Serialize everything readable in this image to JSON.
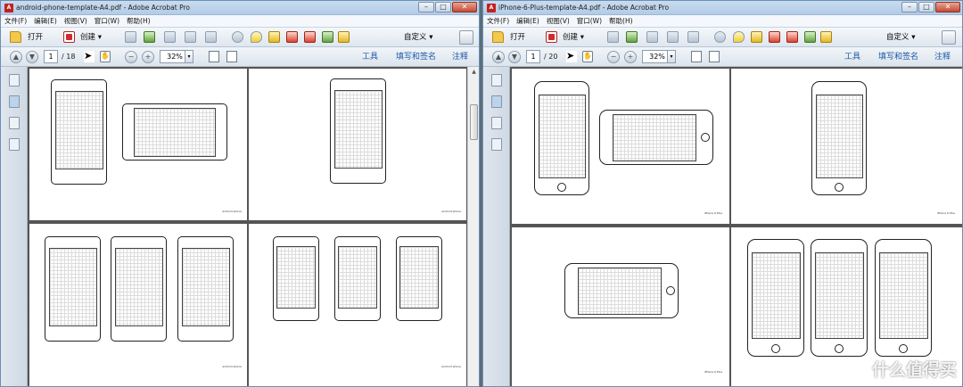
{
  "windows": [
    {
      "title": "android-phone-template-A4.pdf - Adobe Acrobat Pro",
      "menu": [
        "文件(F)",
        "编辑(E)",
        "视图(V)",
        "窗口(W)",
        "帮助(H)"
      ],
      "toolbar": {
        "open_label": "打开",
        "create_label": "创建",
        "customize_label": "自定义"
      },
      "nav": {
        "current_page": "1",
        "total_pages": "/ 18",
        "zoom": "32%",
        "tools_label": "工具",
        "fill_sign_label": "填写和签名",
        "comment_label": "注释"
      },
      "page_captions": [
        "android phone",
        "android phone",
        "android phone",
        "android phone"
      ]
    },
    {
      "title": "iPhone-6-Plus-template-A4.pdf - Adobe Acrobat Pro",
      "menu": [
        "文件(F)",
        "编辑(E)",
        "视图(V)",
        "窗口(W)",
        "帮助(H)"
      ],
      "toolbar": {
        "open_label": "打开",
        "create_label": "创建",
        "customize_label": "自定义"
      },
      "nav": {
        "current_page": "1",
        "total_pages": "/ 20",
        "zoom": "32%",
        "tools_label": "工具",
        "fill_sign_label": "填写和签名",
        "comment_label": "注释"
      },
      "page_captions": [
        "iPhone 6 Plus",
        "iPhone 6 Plus",
        "iPhone 6 Plus",
        "iPhone 6 Plus"
      ]
    }
  ],
  "watermark": {
    "text": "什么值得买"
  },
  "colors": {
    "acrobat_red": "#c3211f",
    "link_blue": "#1e5aa6",
    "title_gradient": "#b3cbe6"
  }
}
